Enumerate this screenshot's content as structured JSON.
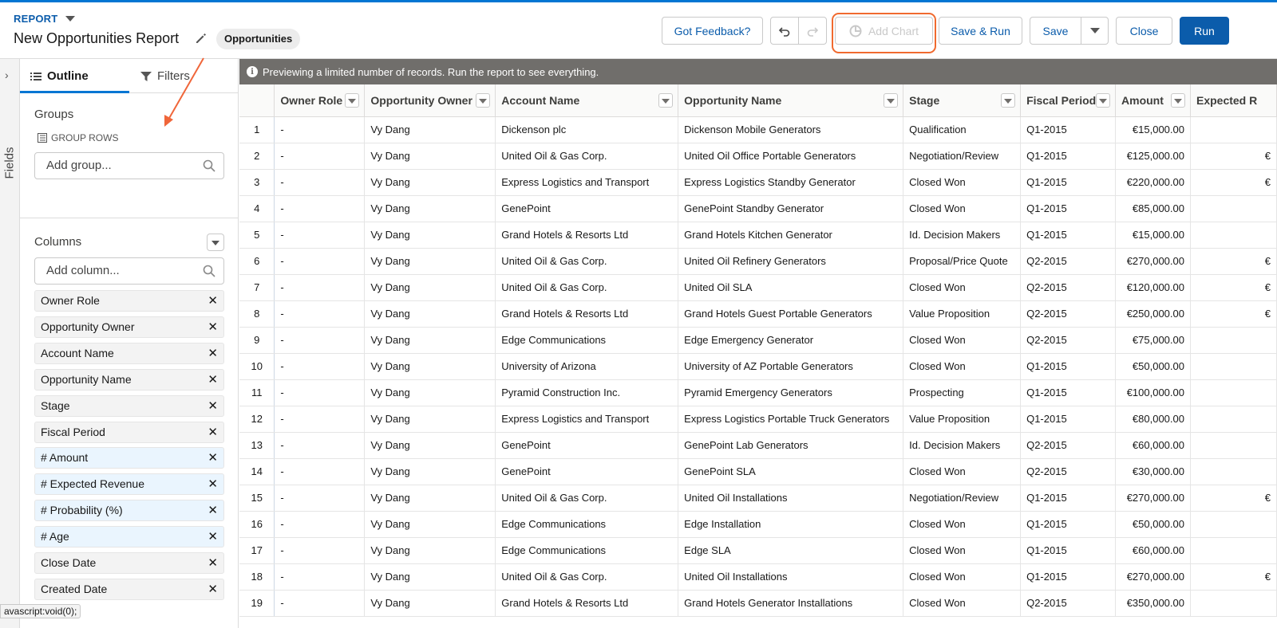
{
  "header": {
    "eyebrow": "REPORT",
    "title": "New Opportunities Report",
    "report_type": "Opportunities",
    "buttons": {
      "feedback": "Got Feedback?",
      "add_chart": "Add Chart",
      "save_run": "Save & Run",
      "save": "Save",
      "close": "Close",
      "run": "Run"
    }
  },
  "rail": {
    "label": "Fields"
  },
  "panel": {
    "tabs": {
      "outline": "Outline",
      "filters": "Filters"
    },
    "groups_title": "Groups",
    "group_rows_label": "GROUP ROWS",
    "add_group_placeholder": "Add group...",
    "columns_title": "Columns",
    "add_column_placeholder": "Add column...",
    "columns": [
      {
        "label": "Owner Role",
        "numeric": false
      },
      {
        "label": "Opportunity Owner",
        "numeric": false
      },
      {
        "label": "Account Name",
        "numeric": false
      },
      {
        "label": "Opportunity Name",
        "numeric": false
      },
      {
        "label": "Stage",
        "numeric": false
      },
      {
        "label": "Fiscal Period",
        "numeric": false
      },
      {
        "label": "# Amount",
        "numeric": true
      },
      {
        "label": "# Expected Revenue",
        "numeric": true
      },
      {
        "label": "# Probability (%)",
        "numeric": true
      },
      {
        "label": "# Age",
        "numeric": true
      },
      {
        "label": "Close Date",
        "numeric": false
      },
      {
        "label": "Created Date",
        "numeric": false
      }
    ]
  },
  "status_tip": "avascript:void(0);",
  "preview_msg": "Previewing a limited number of records. Run the report to see everything.",
  "table": {
    "headers": [
      "Owner Role",
      "Opportunity Owner",
      "Account Name",
      "Opportunity Name",
      "Stage",
      "Fiscal Period",
      "Amount",
      "Expected R"
    ],
    "rows": [
      [
        "1",
        "-",
        "Vy Dang",
        "Dickenson plc",
        "Dickenson Mobile Generators",
        "Qualification",
        "Q1-2015",
        "€15,000.00",
        ""
      ],
      [
        "2",
        "-",
        "Vy Dang",
        "United Oil & Gas Corp.",
        "United Oil Office Portable Generators",
        "Negotiation/Review",
        "Q1-2015",
        "€125,000.00",
        "€"
      ],
      [
        "3",
        "-",
        "Vy Dang",
        "Express Logistics and Transport",
        "Express Logistics Standby Generator",
        "Closed Won",
        "Q1-2015",
        "€220,000.00",
        "€"
      ],
      [
        "4",
        "-",
        "Vy Dang",
        "GenePoint",
        "GenePoint Standby Generator",
        "Closed Won",
        "Q1-2015",
        "€85,000.00",
        ""
      ],
      [
        "5",
        "-",
        "Vy Dang",
        "Grand Hotels & Resorts Ltd",
        "Grand Hotels Kitchen Generator",
        "Id. Decision Makers",
        "Q1-2015",
        "€15,000.00",
        ""
      ],
      [
        "6",
        "-",
        "Vy Dang",
        "United Oil & Gas Corp.",
        "United Oil Refinery Generators",
        "Proposal/Price Quote",
        "Q2-2015",
        "€270,000.00",
        "€"
      ],
      [
        "7",
        "-",
        "Vy Dang",
        "United Oil & Gas Corp.",
        "United Oil SLA",
        "Closed Won",
        "Q2-2015",
        "€120,000.00",
        "€"
      ],
      [
        "8",
        "-",
        "Vy Dang",
        "Grand Hotels & Resorts Ltd",
        "Grand Hotels Guest Portable Generators",
        "Value Proposition",
        "Q2-2015",
        "€250,000.00",
        "€"
      ],
      [
        "9",
        "-",
        "Vy Dang",
        "Edge Communications",
        "Edge Emergency Generator",
        "Closed Won",
        "Q2-2015",
        "€75,000.00",
        ""
      ],
      [
        "10",
        "-",
        "Vy Dang",
        "University of Arizona",
        "University of AZ Portable Generators",
        "Closed Won",
        "Q1-2015",
        "€50,000.00",
        ""
      ],
      [
        "11",
        "-",
        "Vy Dang",
        "Pyramid Construction Inc.",
        "Pyramid Emergency Generators",
        "Prospecting",
        "Q1-2015",
        "€100,000.00",
        ""
      ],
      [
        "12",
        "-",
        "Vy Dang",
        "Express Logistics and Transport",
        "Express Logistics Portable Truck Generators",
        "Value Proposition",
        "Q1-2015",
        "€80,000.00",
        ""
      ],
      [
        "13",
        "-",
        "Vy Dang",
        "GenePoint",
        "GenePoint Lab Generators",
        "Id. Decision Makers",
        "Q2-2015",
        "€60,000.00",
        ""
      ],
      [
        "14",
        "-",
        "Vy Dang",
        "GenePoint",
        "GenePoint SLA",
        "Closed Won",
        "Q2-2015",
        "€30,000.00",
        ""
      ],
      [
        "15",
        "-",
        "Vy Dang",
        "United Oil & Gas Corp.",
        "United Oil Installations",
        "Negotiation/Review",
        "Q1-2015",
        "€270,000.00",
        "€"
      ],
      [
        "16",
        "-",
        "Vy Dang",
        "Edge Communications",
        "Edge Installation",
        "Closed Won",
        "Q1-2015",
        "€50,000.00",
        ""
      ],
      [
        "17",
        "-",
        "Vy Dang",
        "Edge Communications",
        "Edge SLA",
        "Closed Won",
        "Q1-2015",
        "€60,000.00",
        ""
      ],
      [
        "18",
        "-",
        "Vy Dang",
        "United Oil & Gas Corp.",
        "United Oil Installations",
        "Closed Won",
        "Q1-2015",
        "€270,000.00",
        "€"
      ],
      [
        "19",
        "-",
        "Vy Dang",
        "Grand Hotels & Resorts Ltd",
        "Grand Hotels Generator Installations",
        "Closed Won",
        "Q2-2015",
        "€350,000.00",
        ""
      ]
    ]
  }
}
